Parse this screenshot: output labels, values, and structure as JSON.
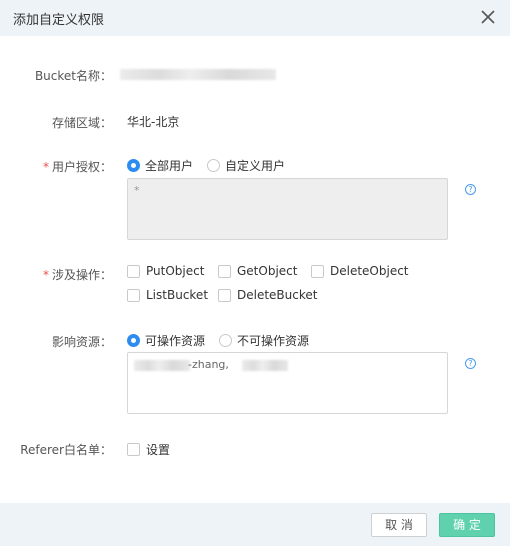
{
  "dialog": {
    "title": "添加自定义权限"
  },
  "bucket": {
    "label": "Bucket名称："
  },
  "region": {
    "label": "存储区域：",
    "value": "华北-北京"
  },
  "user_auth": {
    "required_mark": "*",
    "label": "用户授权：",
    "options": [
      "全部用户",
      "自定义用户"
    ],
    "selected_index": 0,
    "textarea_value": "*"
  },
  "operations": {
    "required_mark": "*",
    "label": "涉及操作：",
    "items": [
      "PutObject",
      "GetObject",
      "DeleteObject",
      "ListBucket",
      "DeleteBucket"
    ]
  },
  "resources": {
    "label": "影响资源：",
    "options": [
      "可操作资源",
      "不可操作资源"
    ],
    "selected_index": 0,
    "textarea_visible_fragment": "-zhang,"
  },
  "referer": {
    "label": "Referer白名单：",
    "checkbox_label": "设置"
  },
  "help": {
    "icon_glyph": "?"
  },
  "footer": {
    "cancel_label": "取 消",
    "ok_label": "确 定"
  },
  "colors": {
    "accent": "#2d8cf0",
    "required": "#f05050",
    "ok_button": "#5fd1ad",
    "header_bg": "#eef3f8"
  }
}
